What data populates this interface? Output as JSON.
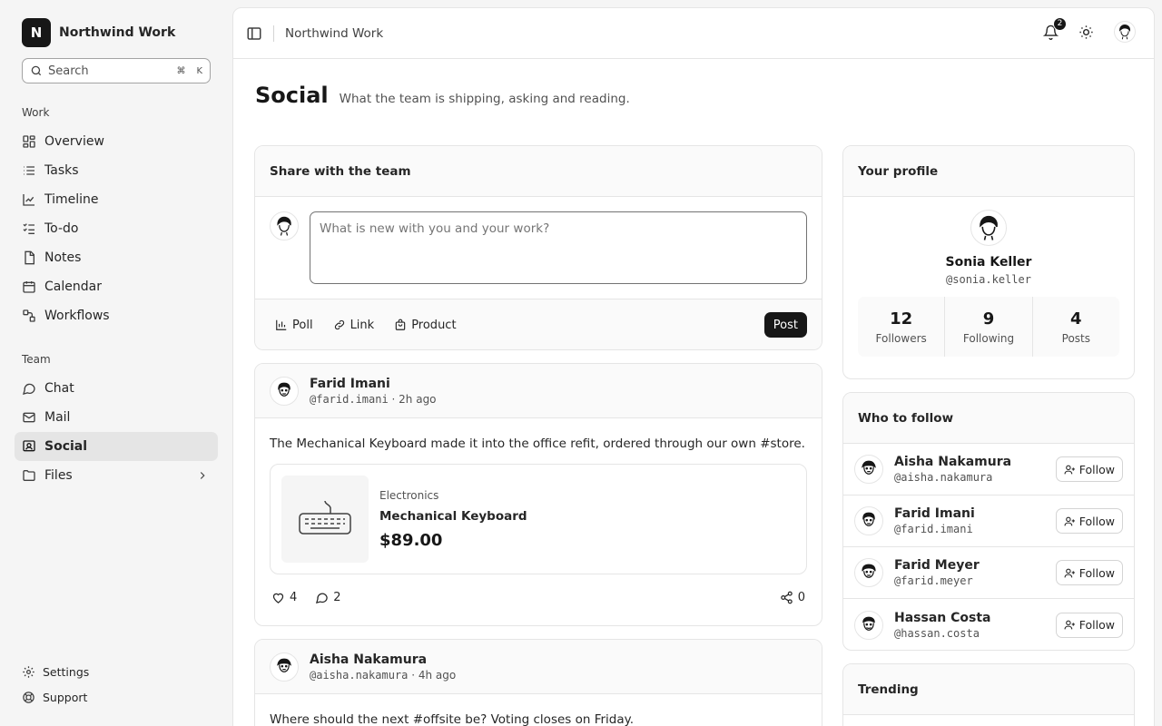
{
  "app": {
    "name": "Northwind Work",
    "logo_letter": "N"
  },
  "search": {
    "placeholder": "Search",
    "kbd": [
      "⌘",
      "K"
    ]
  },
  "sidebar": {
    "work_label": "Work",
    "work_items": [
      {
        "label": "Overview",
        "icon": "grid-icon"
      },
      {
        "label": "Tasks",
        "icon": "list-icon"
      },
      {
        "label": "Timeline",
        "icon": "chart-line-icon"
      },
      {
        "label": "To-do",
        "icon": "checklist-icon"
      },
      {
        "label": "Notes",
        "icon": "note-icon"
      },
      {
        "label": "Calendar",
        "icon": "calendar-icon"
      },
      {
        "label": "Workflows",
        "icon": "workflow-icon"
      }
    ],
    "team_label": "Team",
    "team_items": [
      {
        "label": "Chat",
        "icon": "chat-icon"
      },
      {
        "label": "Mail",
        "icon": "mail-icon"
      },
      {
        "label": "Social",
        "icon": "social-icon",
        "active": true
      },
      {
        "label": "Files",
        "icon": "folder-icon"
      }
    ],
    "footer": {
      "settings": "Settings",
      "support": "Support"
    }
  },
  "topbar": {
    "breadcrumb": "Northwind Work",
    "notifications": "2"
  },
  "page": {
    "title": "Social",
    "subtitle": "What the team is shipping, asking and reading."
  },
  "composer": {
    "title": "Share with the team",
    "placeholder": "What is new with you and your work?",
    "actions": {
      "poll": "Poll",
      "link": "Link",
      "product": "Product"
    },
    "post_label": "Post"
  },
  "posts": [
    {
      "author": "Farid Imani",
      "handle": "@farid.imani",
      "time": "2h ago",
      "text": "The Mechanical Keyboard made it into the office refit, ordered through our own #store.",
      "product": {
        "category": "Electronics",
        "name": "Mechanical Keyboard",
        "price": "$89.00"
      },
      "likes": "4",
      "comments": "2",
      "shares": "0"
    },
    {
      "author": "Aisha Nakamura",
      "handle": "@aisha.nakamura",
      "time": "4h ago",
      "text": "Where should the next #offsite be? Voting closes on Friday."
    }
  ],
  "profile": {
    "title": "Your profile",
    "name": "Sonia Keller",
    "handle": "@sonia.keller",
    "followers": "12",
    "followers_label": "Followers",
    "following": "9",
    "following_label": "Following",
    "posts": "4",
    "posts_label": "Posts"
  },
  "who_to_follow": {
    "title": "Who to follow",
    "follow_label": "Follow",
    "people": [
      {
        "name": "Aisha Nakamura",
        "handle": "@aisha.nakamura"
      },
      {
        "name": "Farid Imani",
        "handle": "@farid.imani"
      },
      {
        "name": "Farid Meyer",
        "handle": "@farid.meyer"
      },
      {
        "name": "Hassan Costa",
        "handle": "@hassan.costa"
      }
    ]
  },
  "trending": {
    "title": "Trending"
  }
}
